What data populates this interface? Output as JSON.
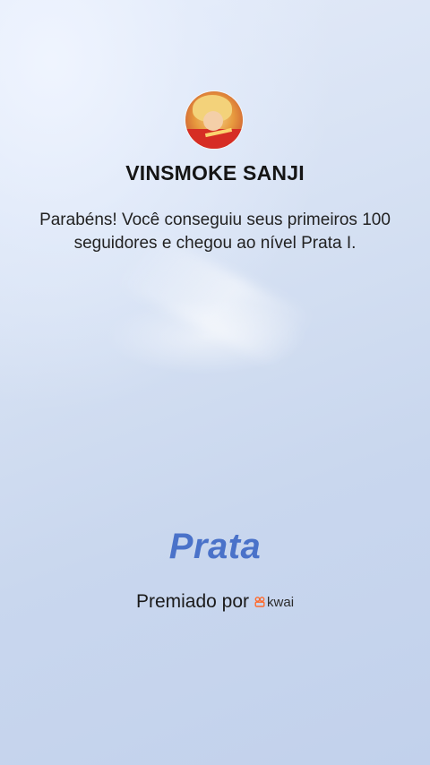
{
  "profile": {
    "username": "VINSMOKE SANJI",
    "avatar_icon": "avatar-image"
  },
  "message": "Parabéns! Você conseguiu seus primeiros 100 seguidores e chegou ao nível Prata I.",
  "level": {
    "name": "Prata"
  },
  "awarded": {
    "label": "Premiado por",
    "brand_name": "kwai",
    "brand_icon": "kwai-logo-icon"
  },
  "colors": {
    "level_text": "#4a72c9",
    "brand_orange": "#ff6a2b"
  }
}
